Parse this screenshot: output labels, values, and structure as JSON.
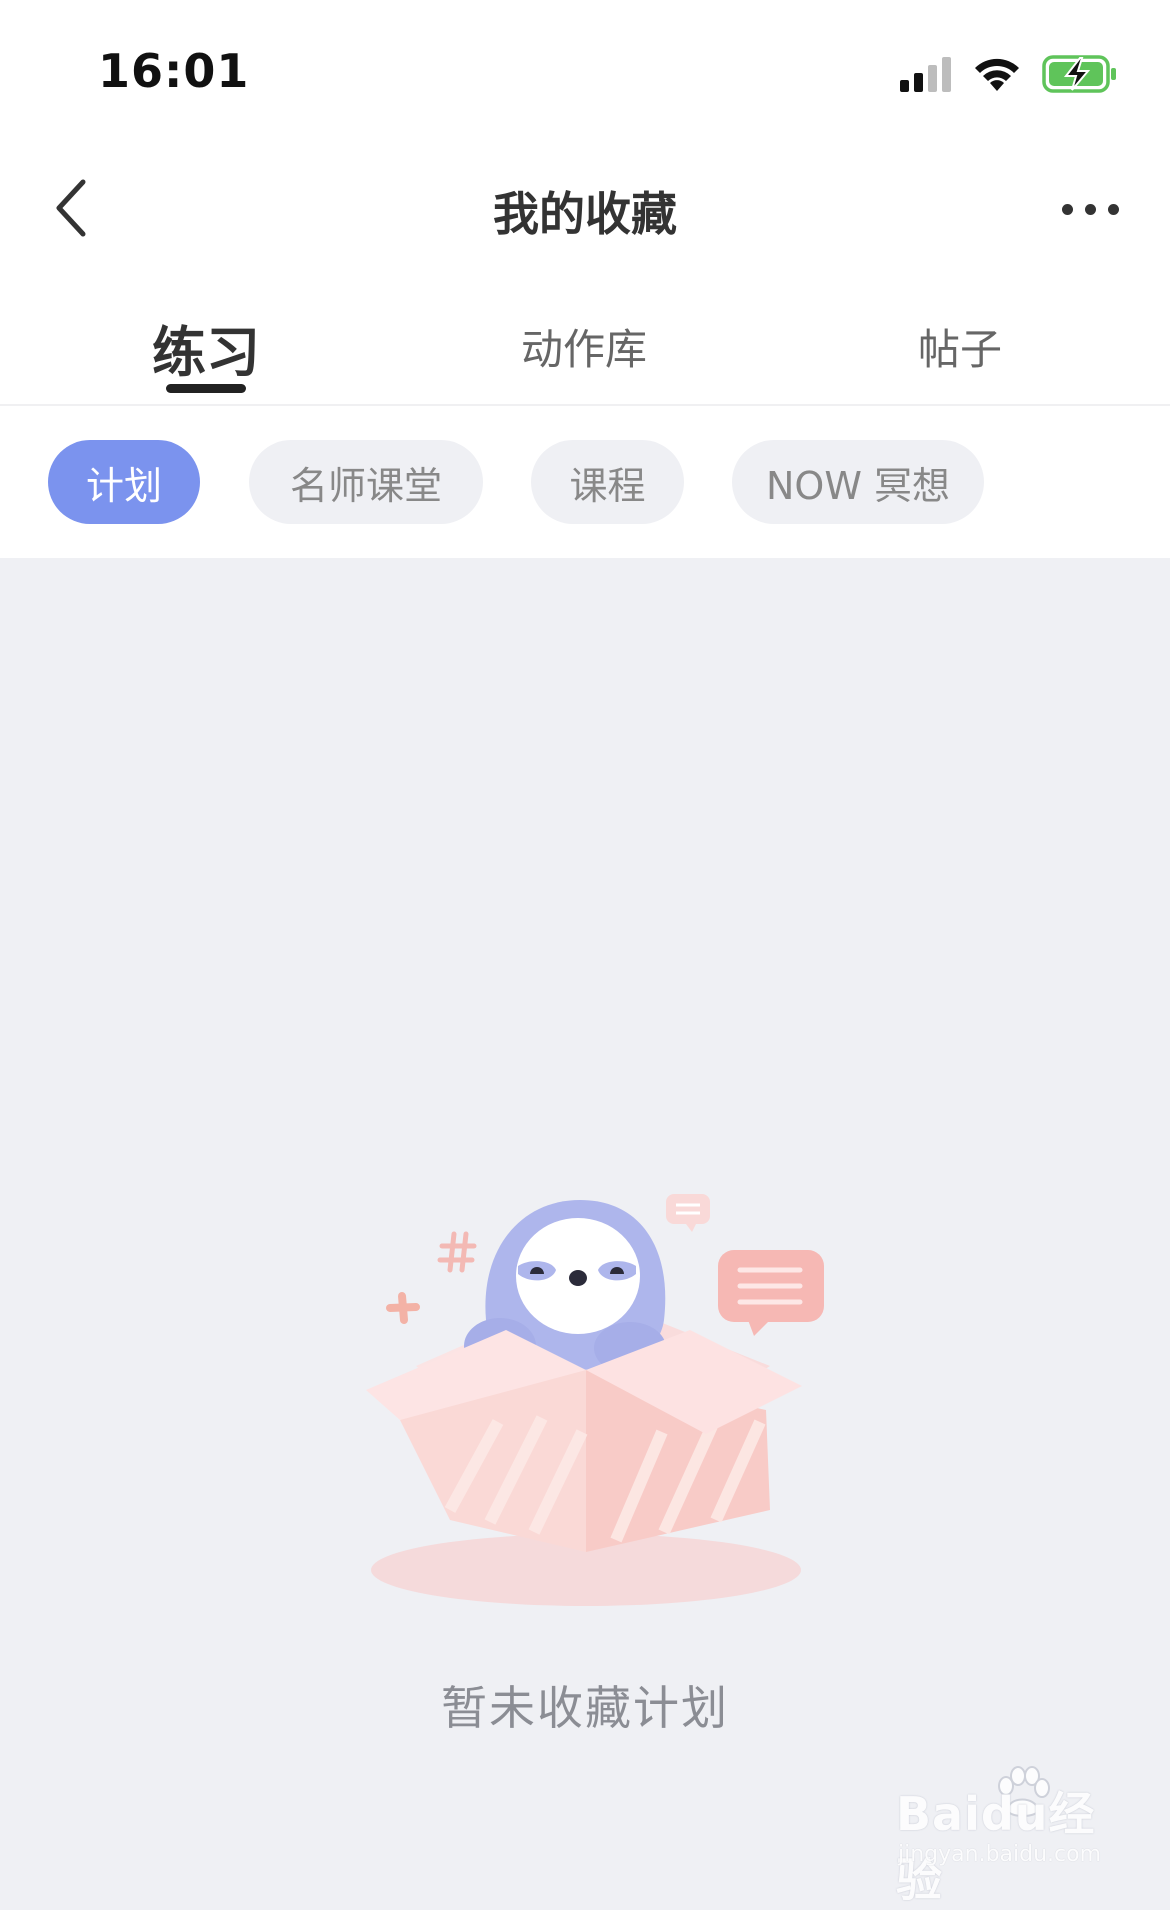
{
  "status_bar": {
    "time": "16:01"
  },
  "header": {
    "title": "我的收藏"
  },
  "tabs": [
    {
      "label": "练习",
      "active": true
    },
    {
      "label": "动作库",
      "active": false
    },
    {
      "label": "帖子",
      "active": false
    }
  ],
  "filters": [
    {
      "label": "计划",
      "active": true
    },
    {
      "label": "名师课堂",
      "active": false
    },
    {
      "label": "课程",
      "active": false
    },
    {
      "label": "NOW 冥想",
      "active": false
    }
  ],
  "empty_state": {
    "message": "暂未收藏计划"
  },
  "watermark": {
    "main": "Baidu经验",
    "sub": "jingyan.baidu.com"
  },
  "colors": {
    "accent": "#7b93ee",
    "page_bg": "#eff0f4",
    "mascot": "#aeb6ec",
    "box": "#f7d6d6"
  }
}
